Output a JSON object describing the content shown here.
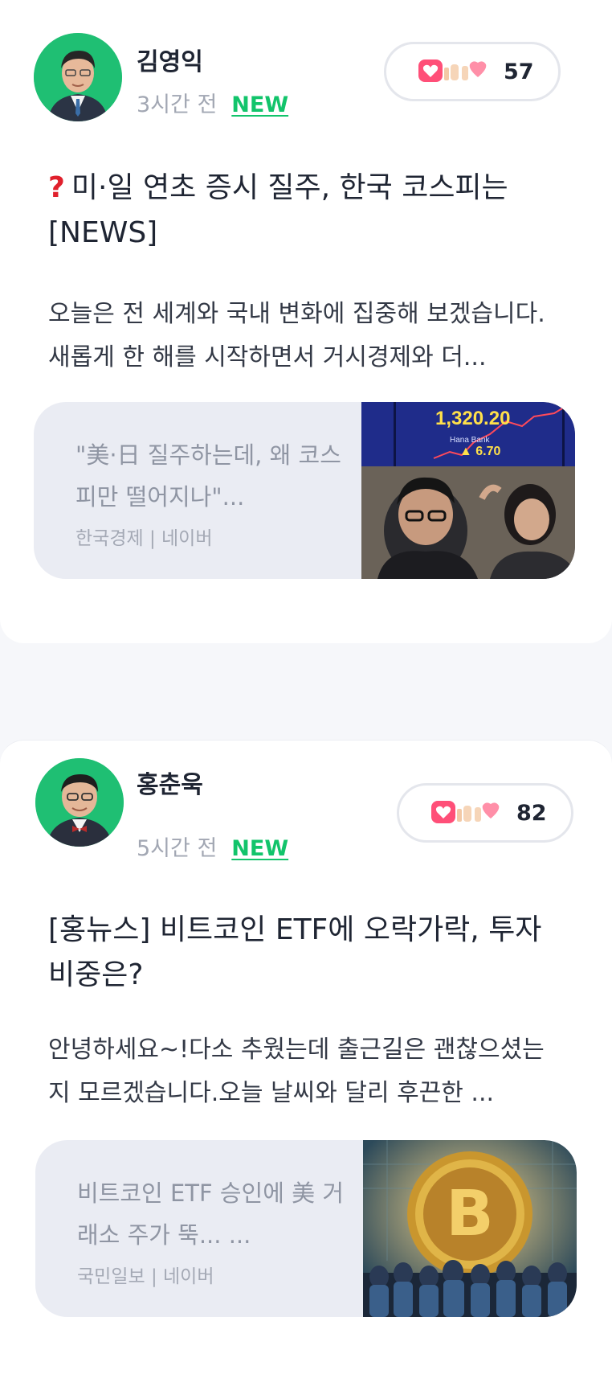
{
  "posts": [
    {
      "author": "김영익",
      "time": "3시간 전",
      "badge": "NEW",
      "reaction_count": "57",
      "title_prefix_icon": "question-mark-icon",
      "title": "미·일 연초 증시 질주, 한국 코스피는 [NEWS]",
      "summary": "오늘은 전 세계와 국내 변화에 집중해 보겠습니다. 새롭게 한 해를 시작하면서 거시경제와 더...",
      "link": {
        "headline": "\"美·日 질주하는데, 왜 코스피만 떨어지나\"...",
        "source": "한국경제 | 네이버",
        "thumb_value": "1,320.20",
        "thumb_change": "▲ 6.70",
        "thumb_brand": "Hana Bank"
      }
    },
    {
      "author": "홍춘욱",
      "time": "5시간 전",
      "badge": "NEW",
      "reaction_count": "82",
      "title": "[홍뉴스] 비트코인 ETF에 오락가락, 투자 비중은?",
      "summary": "안녕하세요~!다소 추웠는데 출근길은 괜찮으셨는지 모르겠습니다.오늘 날씨와 달리 후끈한 ...",
      "link": {
        "headline": "비트코인 ETF 승인에 美 거래소 주가 뚝... ...",
        "source": "국민일보 | 네이버"
      }
    }
  ],
  "colors": {
    "accent_green": "#12c46b",
    "avatar_bg": "#1fbf73",
    "link_card_bg": "#eaecf3",
    "question_red": "#e0202c"
  }
}
